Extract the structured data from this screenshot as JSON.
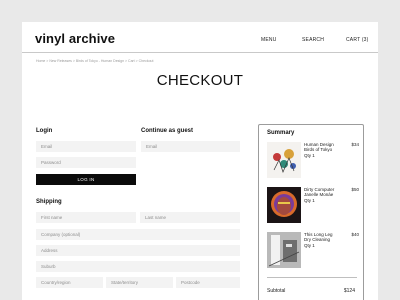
{
  "header": {
    "logo": "vinyl archive",
    "nav": {
      "menu": "MENU",
      "search": "SEARCH",
      "cart": "CART (3)"
    }
  },
  "breadcrumb": "Home > New Releases > Birds of Tokyo - Human Design > Cart > Checkout",
  "page_title": "CHECKOUT",
  "login": {
    "title": "Login",
    "email_placeholder": "Email",
    "password_placeholder": "Password",
    "button_label": "LOG IN"
  },
  "guest": {
    "title": "Continue as guest",
    "email_placeholder": "Email"
  },
  "shipping": {
    "title": "Shipping",
    "first_name": "First name",
    "last_name": "Last name",
    "company": "Company (optional)",
    "address": "Address",
    "suburb": "Suburb",
    "country": "Country/region",
    "state": "State/territory",
    "postcode": "Postcode"
  },
  "summary": {
    "title": "Summary",
    "items": [
      {
        "title": "Human Design",
        "artist": "Birds of Tokyo",
        "qty": "Qty 1",
        "price": "$34"
      },
      {
        "title": "Dirty Computer",
        "artist": "Janelle Monáe",
        "qty": "Qty 1",
        "price": "$50"
      },
      {
        "title": "This Long Leg",
        "artist": "Dry Cleaning",
        "qty": "Qty 1",
        "price": "$40"
      }
    ],
    "subtotal_label": "Subtotal",
    "subtotal_value": "$124"
  }
}
